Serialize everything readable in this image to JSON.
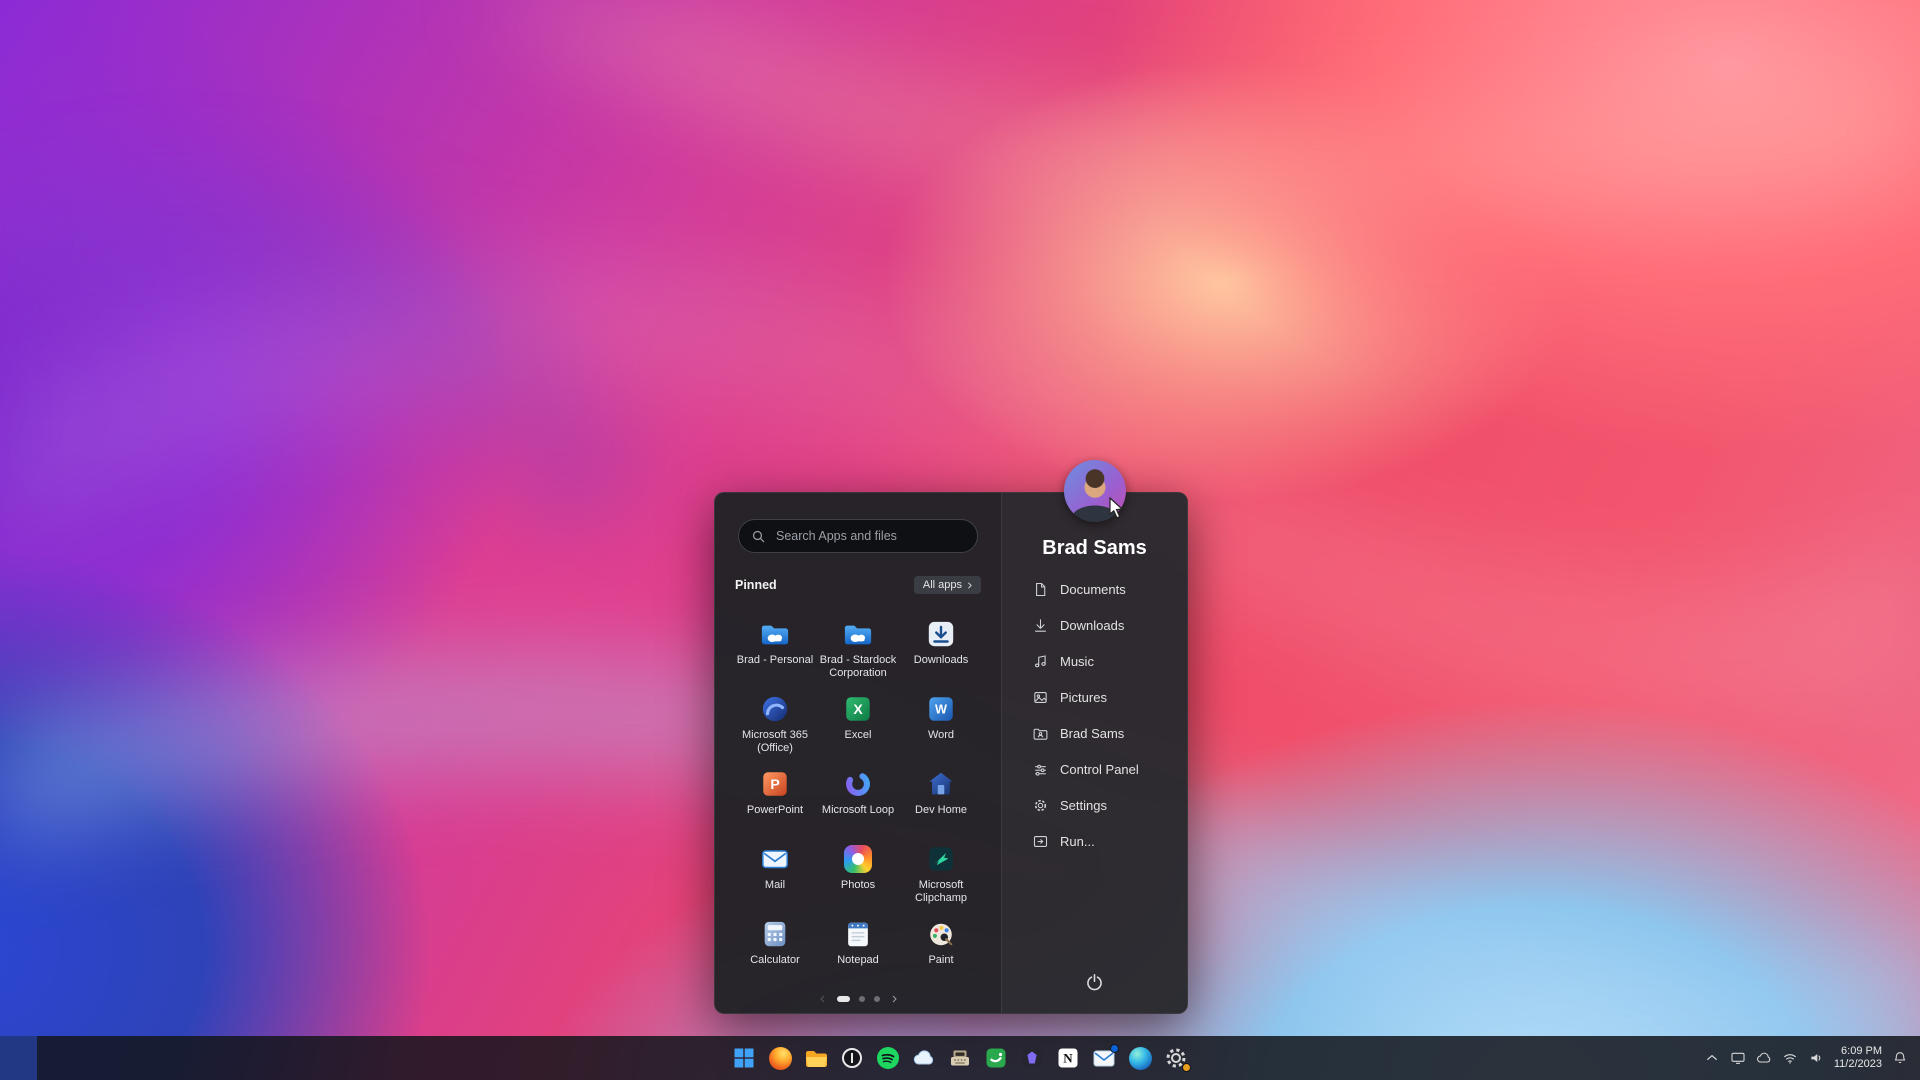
{
  "start_menu": {
    "search": {
      "placeholder": "Search Apps and files",
      "icon": "search-icon"
    },
    "pinned": {
      "title": "Pinned",
      "all_apps_label": "All apps",
      "apps": [
        {
          "label": "Brad - Personal",
          "icon": "onedrive-folder-icon"
        },
        {
          "label": "Brad - Stardock Corporation",
          "icon": "onedrive-folder-icon"
        },
        {
          "label": "Downloads",
          "icon": "downloads-icon"
        },
        {
          "label": "Microsoft 365 (Office)",
          "icon": "microsoft-365-icon"
        },
        {
          "label": "Excel",
          "icon": "excel-icon",
          "letter": "X"
        },
        {
          "label": "Word",
          "icon": "word-icon",
          "letter": "W"
        },
        {
          "label": "PowerPoint",
          "icon": "powerpoint-icon",
          "letter": "P"
        },
        {
          "label": "Microsoft Loop",
          "icon": "loop-icon"
        },
        {
          "label": "Dev Home",
          "icon": "dev-home-icon"
        },
        {
          "label": "Mail",
          "icon": "mail-icon"
        },
        {
          "label": "Photos",
          "icon": "photos-icon"
        },
        {
          "label": "Microsoft Clipchamp",
          "icon": "clipchamp-icon"
        },
        {
          "label": "Calculator",
          "icon": "calculator-icon"
        },
        {
          "label": "Notepad",
          "icon": "notepad-icon"
        },
        {
          "label": "Paint",
          "icon": "paint-icon"
        }
      ]
    },
    "pagination": {
      "page_count": 3,
      "active_page": 1
    },
    "profile": {
      "name": "Brad Sams",
      "avatar": "user-avatar-photo"
    },
    "quick_links": [
      {
        "label": "Documents",
        "icon": "document-icon"
      },
      {
        "label": "Downloads",
        "icon": "download-icon"
      },
      {
        "label": "Music",
        "icon": "music-icon"
      },
      {
        "label": "Pictures",
        "icon": "pictures-icon"
      },
      {
        "label": "Brad Sams",
        "icon": "user-folder-icon"
      },
      {
        "label": "Control Panel",
        "icon": "control-panel-icon"
      },
      {
        "label": "Settings",
        "icon": "settings-icon"
      },
      {
        "label": "Run...",
        "icon": "run-icon"
      }
    ],
    "power": {
      "icon": "power-icon"
    }
  },
  "taskbar": {
    "buttons": [
      {
        "name": "start",
        "icon": "windows-start-icon"
      },
      {
        "name": "firefox",
        "icon": "firefox-icon"
      },
      {
        "name": "file-explorer",
        "icon": "file-explorer-icon"
      },
      {
        "name": "circle-app",
        "icon": "circle-app-icon"
      },
      {
        "name": "spotify",
        "icon": "spotify-icon"
      },
      {
        "name": "cloud-app",
        "icon": "cloud-icon"
      },
      {
        "name": "typewriter-app",
        "icon": "typewriter-icon"
      },
      {
        "name": "green-app",
        "icon": "green-tile-icon"
      },
      {
        "name": "gem-app",
        "icon": "purple-gem-icon"
      },
      {
        "name": "notion",
        "icon": "notion-icon",
        "letter": "N"
      },
      {
        "name": "mail",
        "icon": "mail-envelope-icon"
      },
      {
        "name": "edge",
        "icon": "edge-icon"
      },
      {
        "name": "settings",
        "icon": "settings-gear-icon"
      }
    ],
    "tray": {
      "time": "6:09 PM",
      "date": "11/2/2023",
      "icons": [
        "chevron-up-icon",
        "display-icon",
        "cloud-icon",
        "wifi-icon",
        "volume-icon",
        "bell-icon"
      ]
    }
  }
}
